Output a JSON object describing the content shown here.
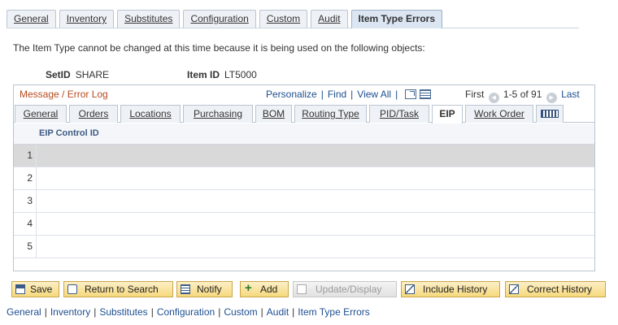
{
  "page_tabs": [
    {
      "label": "General",
      "active": false
    },
    {
      "label": "Inventory",
      "active": false
    },
    {
      "label": "Substitutes",
      "active": false
    },
    {
      "label": "Configuration",
      "active": false
    },
    {
      "label": "Custom",
      "active": false
    },
    {
      "label": "Audit",
      "active": false
    },
    {
      "label": "Item Type Errors",
      "active": true
    }
  ],
  "message": "The Item Type cannot be changed at this time because it is being used on the following objects:",
  "keys": {
    "setid_label": "SetID",
    "setid_value": "SHARE",
    "itemid_label": "Item ID",
    "itemid_value": "LT5000"
  },
  "grid": {
    "title": "Message / Error Log",
    "nav": {
      "personalize": "Personalize",
      "find": "Find",
      "view_all": "View All",
      "zoom_icon": "zoom-icon",
      "download_icon": "download-icon"
    },
    "paging": {
      "first": "First",
      "range": "1-5 of 91",
      "last": "Last"
    },
    "tabs": [
      {
        "label": "General",
        "active": false
      },
      {
        "label": "Orders",
        "active": false
      },
      {
        "label": "Locations",
        "active": false
      },
      {
        "label": "Purchasing",
        "active": false
      },
      {
        "label": "BOM",
        "active": false
      },
      {
        "label": "Routing Type",
        "active": false
      },
      {
        "label": "PID/Task",
        "active": false
      },
      {
        "label": "EIP",
        "active": true
      },
      {
        "label": "Work Order",
        "active": false
      }
    ],
    "column": "EIP Control ID",
    "rows": [
      {
        "num": "1",
        "value": ""
      },
      {
        "num": "2",
        "value": ""
      },
      {
        "num": "3",
        "value": ""
      },
      {
        "num": "4",
        "value": ""
      },
      {
        "num": "5",
        "value": ""
      }
    ]
  },
  "toolbar": {
    "save": "Save",
    "return_to_search": "Return to Search",
    "notify": "Notify",
    "add": "Add",
    "update_display": "Update/Display",
    "include_history": "Include History",
    "correct_history": "Correct History"
  },
  "bottom_links": [
    "General",
    "Inventory",
    "Substitutes",
    "Configuration",
    "Custom",
    "Audit",
    "Item Type Errors"
  ]
}
